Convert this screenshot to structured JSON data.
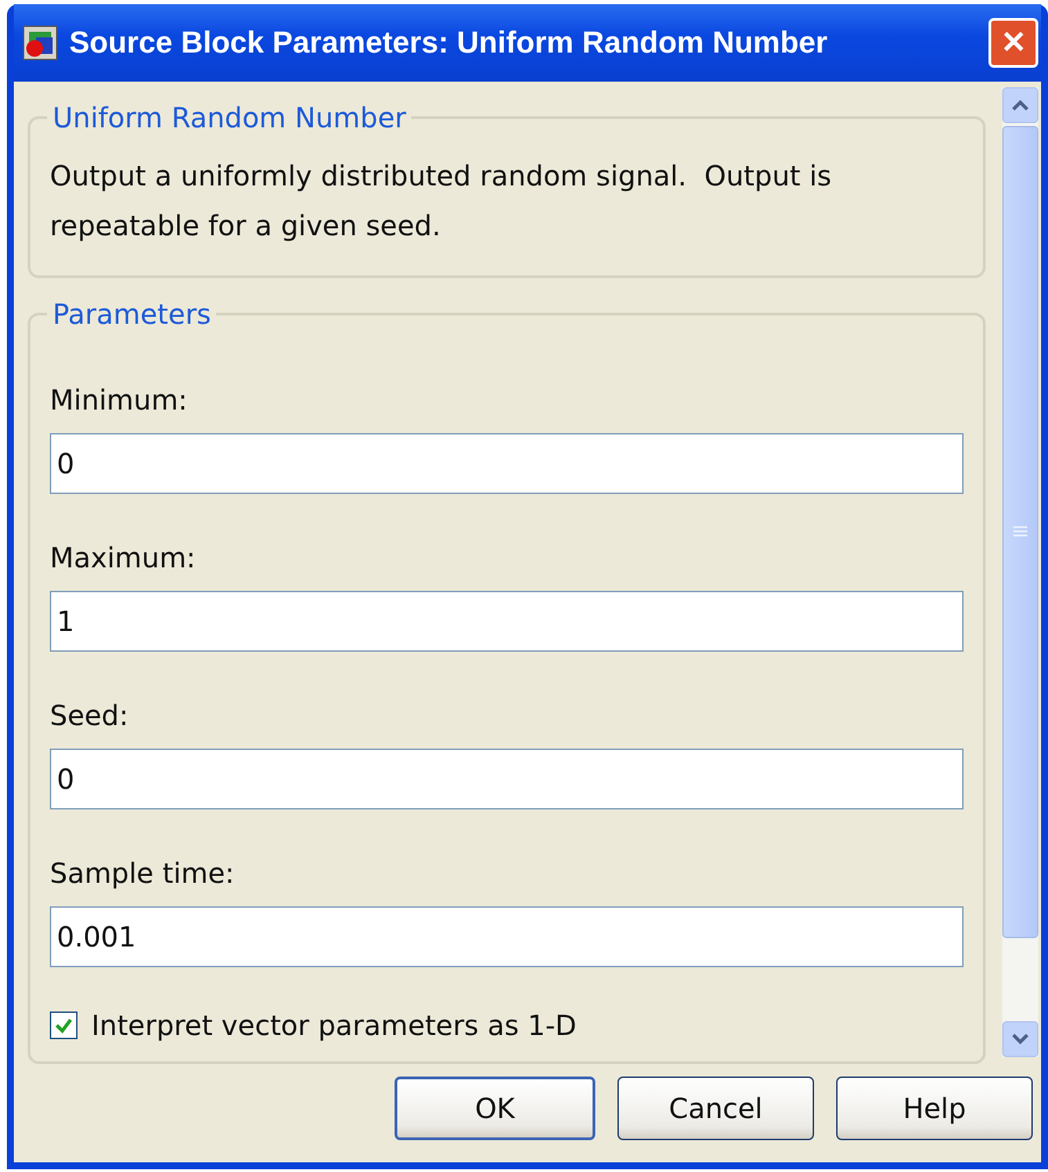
{
  "window": {
    "title": "Source Block Parameters: Uniform Random Number",
    "close": "✕"
  },
  "description_group": {
    "legend": "Uniform Random Number",
    "text": "Output a uniformly distributed random signal.  Output is repeatable for a given seed."
  },
  "parameters_group": {
    "legend": "Parameters",
    "fields": [
      {
        "label": "Minimum:",
        "value": "0"
      },
      {
        "label": "Maximum:",
        "value": "1"
      },
      {
        "label": "Seed:",
        "value": "0"
      },
      {
        "label": "Sample time:",
        "value": "0.001"
      }
    ],
    "checkbox": {
      "label": "Interpret vector parameters as 1-D",
      "checked": true
    }
  },
  "buttons": [
    {
      "label": "OK",
      "selected": true
    },
    {
      "label": "Cancel",
      "selected": false
    },
    {
      "label": "Help",
      "selected": false
    }
  ]
}
